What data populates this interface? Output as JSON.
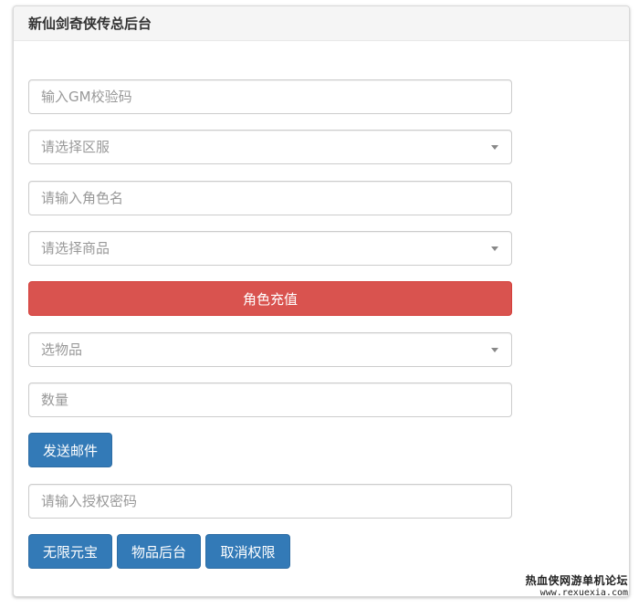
{
  "header": {
    "title": "新仙剑奇侠传总后台"
  },
  "form": {
    "gm_code_placeholder": "输入GM校验码",
    "server_select_placeholder": "请选择区服",
    "role_name_placeholder": "请输入角色名",
    "product_select_placeholder": "请选择商品",
    "recharge_label": "角色充值",
    "item_select_placeholder": "选物品",
    "quantity_placeholder": "数量",
    "send_mail_label": "发送邮件",
    "auth_password_placeholder": "请输入授权密码",
    "unlimited_yuanbao_label": "无限元宝",
    "item_backend_label": "物品后台",
    "revoke_permission_label": "取消权限"
  },
  "watermark": {
    "text": "热血侠网游单机论坛",
    "url": "www.rexuexia.com"
  },
  "colors": {
    "danger": "#d9534f",
    "primary": "#337ab7"
  }
}
